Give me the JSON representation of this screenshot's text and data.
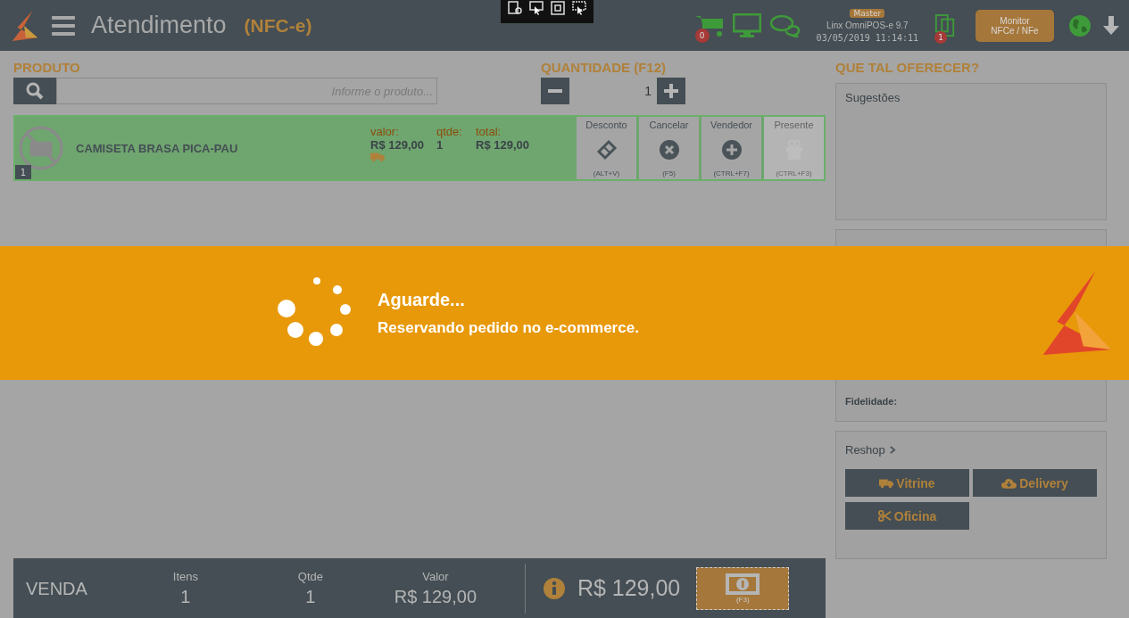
{
  "header": {
    "title": "Atendimento",
    "mode": "(NFC-e)",
    "cart_count": "0",
    "profile": "Master",
    "app_version": "Linx OmniPOS-e  9.7",
    "datetime": "03/05/2019 11:14:11",
    "docs_count": "1",
    "monitor_button": [
      "Monitor",
      "NFCe / NFe"
    ]
  },
  "product": {
    "label": "PRODUTO",
    "placeholder": "Informe o produto..."
  },
  "quantity": {
    "label": "QUANTIDADE (F12)",
    "value": "1"
  },
  "items": [
    {
      "index": "1",
      "name": "CAMISETA BRASA PICA-PAU",
      "valor_label": "valor:",
      "valor": "R$ 129,00",
      "qtde_label": "qtde:",
      "qtde": "1",
      "total_label": "total:",
      "total": "R$ 129,00",
      "actions": [
        {
          "label": "Desconto",
          "shortcut": "(ALT+V)",
          "disabled": false
        },
        {
          "label": "Cancelar",
          "shortcut": "(F5)",
          "disabled": false
        },
        {
          "label": "Vendedor",
          "shortcut": "(CTRL+F7)",
          "disabled": false
        },
        {
          "label": "Presente",
          "shortcut": "(CTRL+F3)",
          "disabled": true
        }
      ]
    }
  ],
  "suggestions": {
    "title": "QUE TAL OFERECER?",
    "box_title": "Sugestões"
  },
  "customer": {
    "lines": [
      "Fidelidade:"
    ]
  },
  "reshop": {
    "title": "Reshop",
    "buttons": [
      {
        "label": "Vitrine"
      },
      {
        "label": "Delivery"
      },
      {
        "label": "Oficina"
      }
    ]
  },
  "summary": {
    "title": "VENDA",
    "stats": [
      {
        "label": "Itens",
        "value": "1"
      },
      {
        "label": "Qtde",
        "value": "1"
      },
      {
        "label": "Valor",
        "value": "R$ 129,00"
      }
    ],
    "total": "R$ 129,00",
    "pay_shortcut": "(F3)"
  },
  "loading": {
    "title": "Aguarde...",
    "message": "Reservando pedido no e-commerce."
  }
}
